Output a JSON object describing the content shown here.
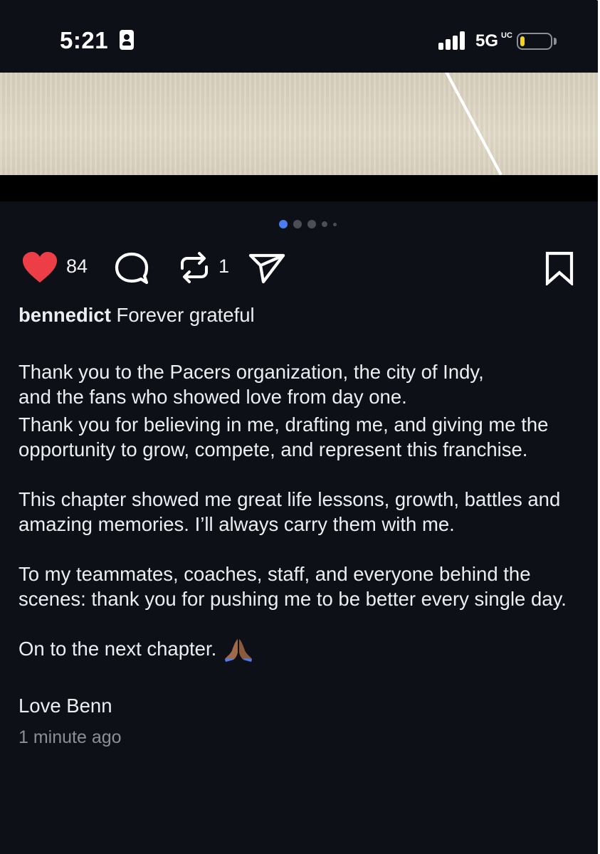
{
  "status_bar": {
    "time": "5:21",
    "network": "5G",
    "network_sub": "UC",
    "battery_color": "#f4d21e"
  },
  "carousel": {
    "page_count": 5,
    "active_index": 0,
    "active_color": "#4a7cf2"
  },
  "actions": {
    "likes": "84",
    "reposts": "1",
    "like_color": "#ed3e47"
  },
  "post": {
    "username": "bennedict",
    "title": "Forever grateful",
    "paragraph1_line1": "Thank you to the Pacers organization, the city of Indy,",
    "paragraph1_line2": "and the fans who showed love from day one.",
    "paragraph2": "Thank you for believing in me, drafting me, and giving me the opportunity to grow, compete, and represent this franchise.",
    "paragraph3": "This chapter showed me great life lessons, growth, battles and amazing memories. I’ll always carry them with me.",
    "paragraph4": "To my teammates, coaches, staff, and everyone behind the scenes: thank you for pushing me to be better every single day.",
    "paragraph5": "On to the next chapter.",
    "signoff": "Love Benn",
    "timestamp": "1 minute ago"
  }
}
